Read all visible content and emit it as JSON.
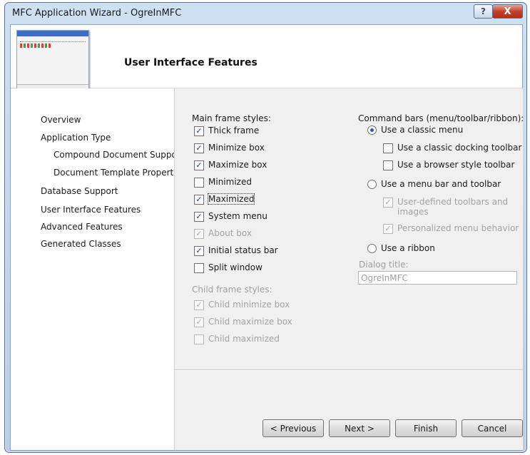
{
  "window": {
    "title": "MFC Application Wizard - OgreInMFC",
    "help_label": "?",
    "close_label": "X"
  },
  "header": {
    "title": "User Interface Features",
    "thumb_menu_items": [
      "EDIT",
      "VIEW",
      "CLASS",
      "PROJECT",
      "BUILD",
      "HELP"
    ]
  },
  "nav": {
    "items": [
      {
        "label": "Overview",
        "level": 0
      },
      {
        "label": "Application Type",
        "level": 0
      },
      {
        "label": "Compound Document Support",
        "level": 1
      },
      {
        "label": "Document Template Properties",
        "level": 1
      },
      {
        "label": "Database Support",
        "level": 0
      },
      {
        "label": "User Interface Features",
        "level": 0,
        "selected": true
      },
      {
        "label": "Advanced Features",
        "level": 0
      },
      {
        "label": "Generated Classes",
        "level": 0
      }
    ]
  },
  "main_frame": {
    "title": "Main frame styles:",
    "options": [
      {
        "label": "Thick frame",
        "checked": true,
        "enabled": true
      },
      {
        "label": "Minimize box",
        "checked": true,
        "enabled": true
      },
      {
        "label": "Maximize box",
        "checked": true,
        "enabled": true
      },
      {
        "label": "Minimized",
        "checked": false,
        "enabled": true
      },
      {
        "label": "Maximized",
        "checked": true,
        "enabled": true,
        "focused": true
      },
      {
        "label": "System menu",
        "checked": true,
        "enabled": true
      },
      {
        "label": "About box",
        "checked": true,
        "enabled": false
      },
      {
        "label": "Initial status bar",
        "checked": true,
        "enabled": true
      },
      {
        "label": "Split window",
        "checked": false,
        "enabled": true
      }
    ]
  },
  "child_frame": {
    "title": "Child frame styles:",
    "options": [
      {
        "label": "Child minimize box",
        "checked": true,
        "enabled": false
      },
      {
        "label": "Child maximize box",
        "checked": true,
        "enabled": false
      },
      {
        "label": "Child maximized",
        "checked": false,
        "enabled": false
      }
    ]
  },
  "command_bars": {
    "title": "Command bars (menu/toolbar/ribbon):",
    "classic_menu": {
      "label": "Use a classic menu",
      "selected": true
    },
    "classic_docking": {
      "label": "Use a classic docking toolbar",
      "checked": false
    },
    "browser_style": {
      "label": "Use a browser style toolbar",
      "checked": false
    },
    "menu_bar_toolbar": {
      "label": "Use a menu bar and toolbar",
      "selected": false
    },
    "user_defined": {
      "label": "User-defined toolbars and images",
      "checked": true
    },
    "personalized": {
      "label": "Personalized menu behavior",
      "checked": true
    },
    "ribbon": {
      "label": "Use a ribbon",
      "selected": false
    }
  },
  "dialog_title": {
    "label": "Dialog title:",
    "value": "OgreInMFC"
  },
  "buttons": {
    "previous": "< Previous",
    "next": "Next >",
    "finish": "Finish",
    "cancel": "Cancel"
  },
  "check_glyph": "✓"
}
